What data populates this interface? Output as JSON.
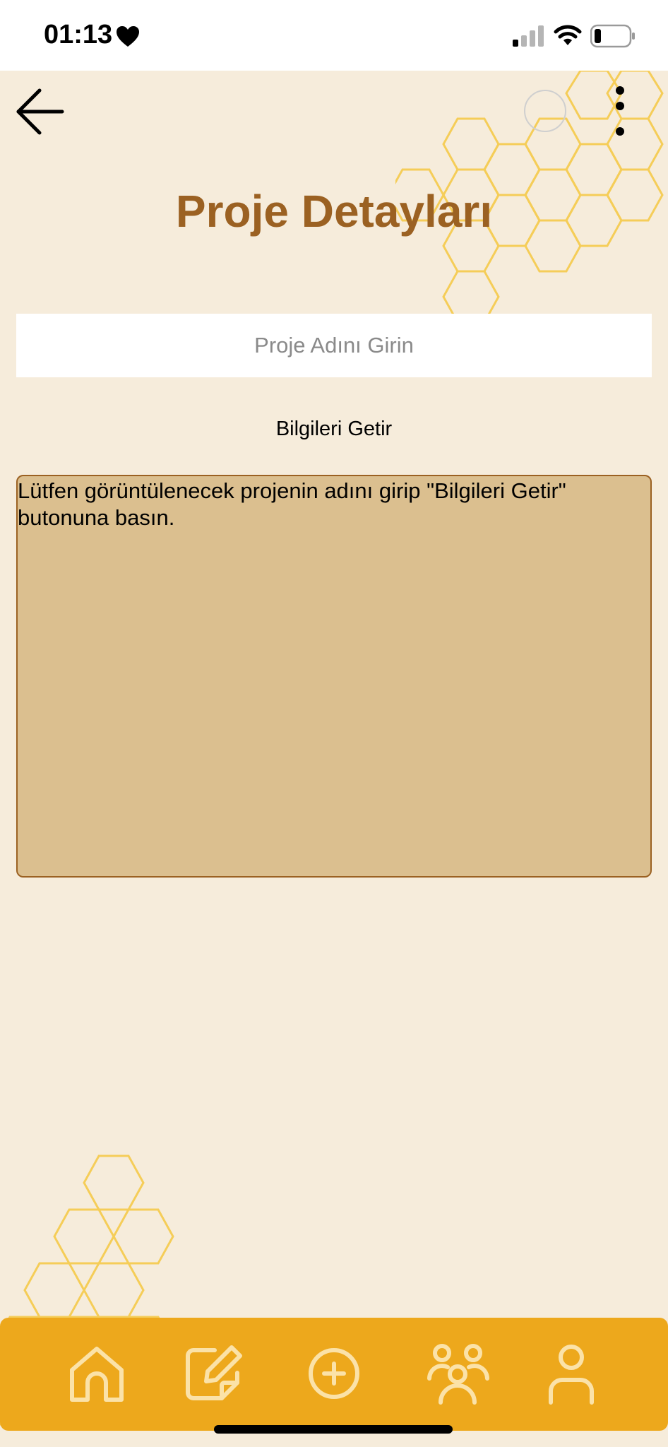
{
  "status_bar": {
    "time": "01:13",
    "icons": [
      "heart-icon",
      "cellular-signal-icon",
      "wifi-icon",
      "battery-icon"
    ]
  },
  "header": {
    "back_icon": "arrow-left-icon",
    "menu_icon": "more-vertical-icon",
    "title": "Proje Detayları"
  },
  "form": {
    "project_name_placeholder": "Proje Adını Girin",
    "project_name_value": "",
    "fetch_button_label": "Bilgileri Getir"
  },
  "info_box": {
    "message": "Lütfen görüntülenecek projenin adını girip \"Bilgileri Getir\" butonuna basın."
  },
  "tab_bar": {
    "items": [
      {
        "icon": "home-icon"
      },
      {
        "icon": "edit-icon"
      },
      {
        "icon": "add-circle-icon"
      },
      {
        "icon": "team-icon"
      },
      {
        "icon": "profile-icon"
      }
    ]
  },
  "colors": {
    "background": "#f6ecdb",
    "title": "#9b6122",
    "info_box_fill": "#dbbf8f",
    "info_box_border": "#9b6122",
    "tab_bar": "#eda81c",
    "honeycomb": "#f5c842"
  }
}
